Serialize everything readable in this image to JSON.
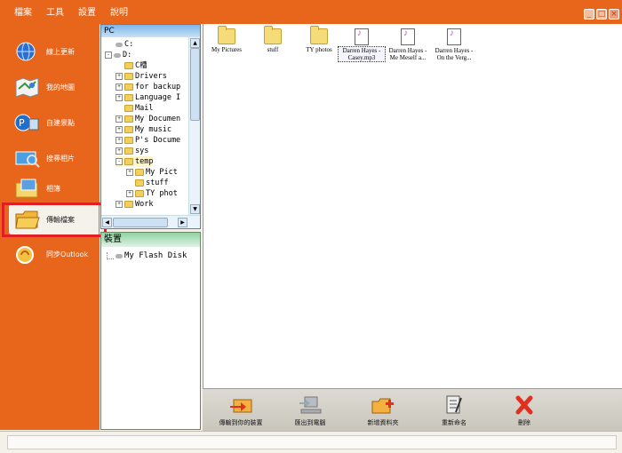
{
  "menu": [
    "檔案",
    "工具",
    "設置",
    "說明"
  ],
  "window_buttons": [
    "_",
    "□",
    "×"
  ],
  "sidebar": {
    "items": [
      {
        "label": "線上更新",
        "icon": "globe-icon"
      },
      {
        "label": "我的地圖",
        "icon": "map-icon"
      },
      {
        "label": "自建景點",
        "icon": "poi-icon"
      },
      {
        "label": "搜尋相片",
        "icon": "search-photo-icon"
      },
      {
        "label": "相簿",
        "icon": "album-icon"
      },
      {
        "label": "傳輸檔案",
        "icon": "transfer-folder-icon",
        "active": true
      },
      {
        "label": "同步Outlook",
        "icon": "outlook-sync-icon"
      }
    ]
  },
  "pc_panel": {
    "title": "PC",
    "tree": [
      {
        "label": "C:",
        "type": "drive",
        "expander": ""
      },
      {
        "label": "D:",
        "type": "drive",
        "expander": "-"
      },
      {
        "label": "C槽",
        "type": "folder",
        "expander": ""
      },
      {
        "label": "Drivers",
        "type": "folder",
        "expander": "+"
      },
      {
        "label": "for backup",
        "type": "folder",
        "expander": "+"
      },
      {
        "label": "Language I",
        "type": "folder",
        "expander": "+"
      },
      {
        "label": "Mail",
        "type": "folder",
        "expander": ""
      },
      {
        "label": "My Documen",
        "type": "folder",
        "expander": "+"
      },
      {
        "label": "My music",
        "type": "folder",
        "expander": "+"
      },
      {
        "label": "P's Docume",
        "type": "folder",
        "expander": "+"
      },
      {
        "label": "sys",
        "type": "folder",
        "expander": "+"
      },
      {
        "label": "temp",
        "type": "folder",
        "expander": "-",
        "selected": true
      },
      {
        "label": "My Pict",
        "type": "folder",
        "expander": "+"
      },
      {
        "label": "stuff",
        "type": "folder",
        "expander": ""
      },
      {
        "label": "TY phot",
        "type": "folder",
        "expander": "+"
      },
      {
        "label": "Work",
        "type": "folder",
        "expander": "+"
      }
    ]
  },
  "device_panel": {
    "title": "裝置",
    "devices": [
      "My Flash Disk"
    ]
  },
  "files": [
    {
      "name": "My Pictures",
      "type": "folder-special"
    },
    {
      "name": "stuff",
      "type": "folder"
    },
    {
      "name": "TY photos",
      "type": "folder"
    },
    {
      "name": "Darren Hayes - Casey.mp3",
      "line1": "Darren Hayes -",
      "line2": "Casey.mp3",
      "type": "mp3",
      "selected": true
    },
    {
      "name": "Darren Hayes - Me Meself a...",
      "line1": "Darren Hayes -",
      "line2": "Me Meself a...",
      "type": "mp3"
    },
    {
      "name": "Darren Hayes - On the Verg...",
      "line1": "Darren Hayes -",
      "line2": "On the Verg...",
      "type": "mp3"
    }
  ],
  "toolbar": {
    "buttons": [
      {
        "label": "傳輸到你的裝置",
        "icon": "send-to-device-icon"
      },
      {
        "label": "匯出到電腦",
        "icon": "export-to-pc-icon"
      },
      {
        "label": "新增資料夾",
        "icon": "new-folder-icon"
      },
      {
        "label": "重新命名",
        "icon": "rename-icon"
      },
      {
        "label": "刪除",
        "icon": "delete-icon"
      }
    ]
  },
  "colors": {
    "accent": "#e8651c",
    "highlight_box": "#e02020"
  }
}
